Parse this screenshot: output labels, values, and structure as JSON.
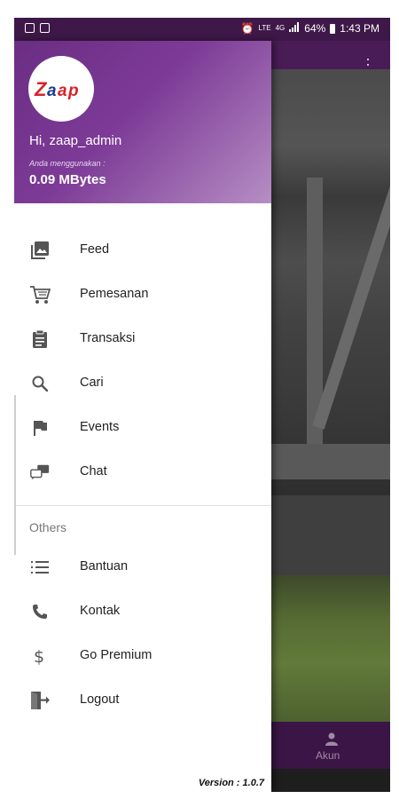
{
  "status_bar": {
    "battery": "64%",
    "time": "1:43 PM",
    "network": "4G",
    "lte": "LTE"
  },
  "drawer": {
    "logo_text": "Zaap",
    "greeting": "Hi, zaap_admin",
    "usage_label": "Anda menggunakan :",
    "usage_value": "0.09 MBytes",
    "main_items": [
      {
        "label": "Feed",
        "icon": "image-gallery-icon"
      },
      {
        "label": "Pemesanan",
        "icon": "cart-icon"
      },
      {
        "label": "Transaksi",
        "icon": "clipboard-icon"
      },
      {
        "label": "Cari",
        "icon": "search-icon"
      },
      {
        "label": "Events",
        "icon": "flag-icon"
      },
      {
        "label": "Chat",
        "icon": "chat-icon"
      }
    ],
    "section_title": "Others",
    "other_items": [
      {
        "label": "Bantuan",
        "icon": "list-icon"
      },
      {
        "label": "Kontak",
        "icon": "phone-icon"
      },
      {
        "label": "Go Premium",
        "icon": "dollar-icon"
      },
      {
        "label": "Logout",
        "icon": "logout-icon"
      }
    ],
    "version": "Version : 1.0.7"
  },
  "background_app": {
    "bottom_nav_label": "Akun"
  },
  "colors": {
    "header_purple": "#7d3b97",
    "status_bar": "#3e1848",
    "logo_red": "#d8232a",
    "logo_blue": "#1a3d8f"
  }
}
